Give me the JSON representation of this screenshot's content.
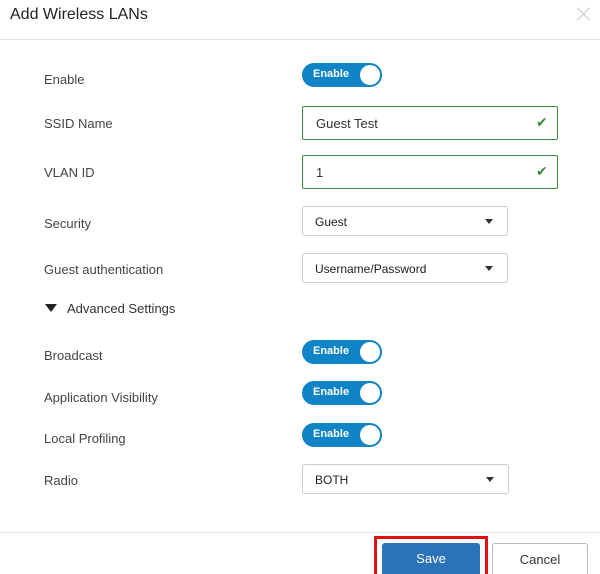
{
  "dialog": {
    "title": "Add Wireless LANs"
  },
  "form": {
    "enable": {
      "label": "Enable",
      "state": "Enable"
    },
    "ssid": {
      "label": "SSID Name",
      "value": "Guest Test"
    },
    "vlan": {
      "label": "VLAN ID",
      "value": "1"
    },
    "security": {
      "label": "Security",
      "value": "Guest"
    },
    "guest_auth": {
      "label": "Guest authentication",
      "value": "Username/Password"
    },
    "advanced": {
      "label": "Advanced Settings"
    },
    "broadcast": {
      "label": "Broadcast",
      "state": "Enable"
    },
    "app_visibility": {
      "label": "Application Visibility",
      "state": "Enable"
    },
    "local_profiling": {
      "label": "Local Profiling",
      "state": "Enable"
    },
    "radio": {
      "label": "Radio",
      "value": "BOTH"
    }
  },
  "footer": {
    "save_label": "Save",
    "cancel_label": "Cancel"
  },
  "colors": {
    "toggle_on": "#0e83c5",
    "valid_border": "#3a8c3a",
    "save_button": "#2b73b8",
    "highlight": "#dd1111"
  },
  "icons": {
    "close": "close-icon",
    "valid": "checkmark-icon",
    "dropdown": "chevron-down-icon",
    "collapse": "triangle-down-icon"
  }
}
